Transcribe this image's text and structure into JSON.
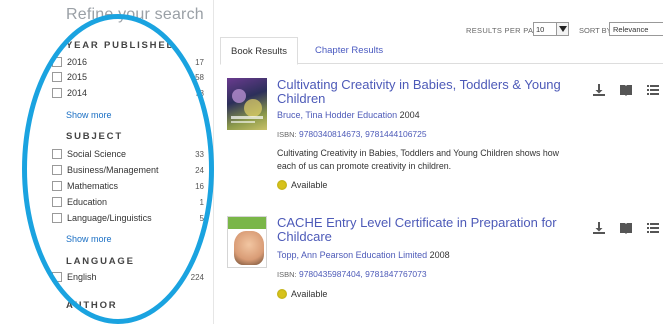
{
  "sidebar": {
    "refine_title": "Refine your search",
    "facets": [
      {
        "heading": "YEAR PUBLISHED",
        "items": [
          {
            "label": "2016",
            "count": "17"
          },
          {
            "label": "2015",
            "count": "58"
          },
          {
            "label": "2014",
            "count": "78"
          }
        ],
        "show_more": "Show more"
      },
      {
        "heading": "SUBJECT",
        "items": [
          {
            "label": "Social Science",
            "count": "33"
          },
          {
            "label": "Business/Management",
            "count": "24"
          },
          {
            "label": "Mathematics",
            "count": "16"
          },
          {
            "label": "Education",
            "count": "1"
          },
          {
            "label": "Language/Linguistics",
            "count": "5"
          }
        ],
        "show_more": "Show more"
      },
      {
        "heading": "LANGUAGE",
        "items": [
          {
            "label": "English",
            "count": "224"
          }
        ]
      }
    ],
    "next_heading": "AUTHOR"
  },
  "toolbar": {
    "results_per_page_label": "RESULTS PER PAGE",
    "results_per_page_value": "10",
    "sort_by_label": "SORT BY",
    "sort_by_value": "Relevance"
  },
  "tabs": [
    {
      "label": "Book Results",
      "active": true
    },
    {
      "label": "Chapter Results",
      "active": false
    }
  ],
  "results": [
    {
      "title": "Cultivating Creativity in Babies, Toddlers & Young Children",
      "author": "Bruce, Tina",
      "publisher": "Hodder Education",
      "year": "2004",
      "isbn_label": "ISBN:",
      "isbns": "9780340814673, 9781444106725",
      "description": "Cultivating Creativity in Babies, Toddlers and Young Children shows how each of us can promote creativity in children.",
      "availability": "Available"
    },
    {
      "title": "CACHE Entry Level Certificate in Preparation for Childcare",
      "author": "Topp, Ann",
      "publisher": "Pearson Education Limited",
      "year": "2008",
      "isbn_label": "ISBN:",
      "isbns": "9780435987404, 9781847767073",
      "availability": "Available"
    }
  ],
  "colors": {
    "annotation_oval": "#1aa3e0",
    "link": "#4d5ab8",
    "available": "#d7c21b"
  },
  "icons": [
    "download-icon",
    "read-book-icon",
    "table-of-contents-icon",
    "more-icon",
    "available-icon",
    "checkbox-icon"
  ]
}
